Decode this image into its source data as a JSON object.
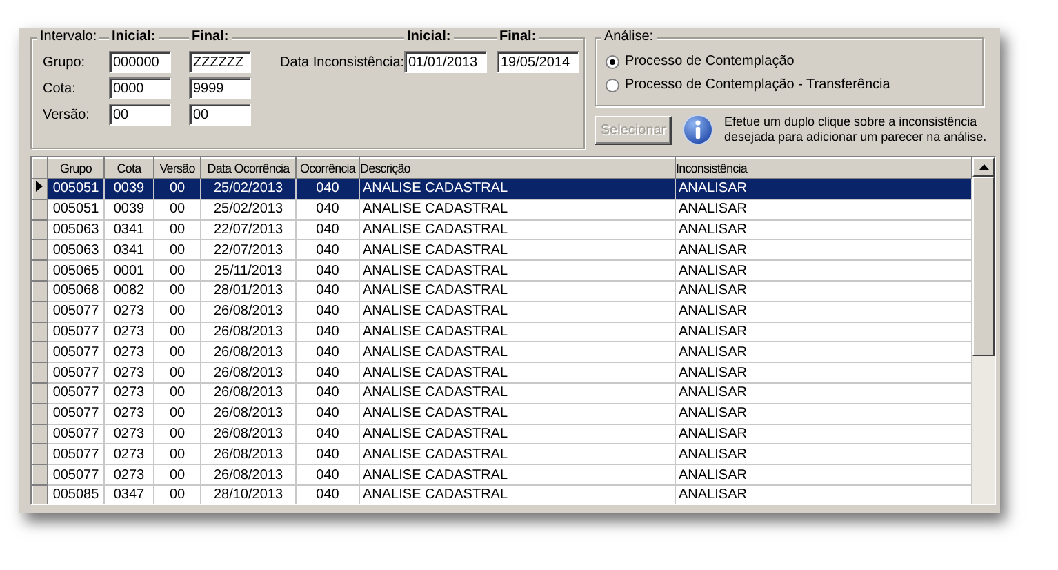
{
  "intervalo": {
    "title": "Intervalo:",
    "col_headers": [
      "Inicial:",
      "Final:"
    ],
    "rows": [
      {
        "label": "Grupo:",
        "inicial": "000000",
        "final": "ZZZZZZ"
      },
      {
        "label": "Cota:",
        "inicial": "0000",
        "final": "9999"
      },
      {
        "label": "Versão:",
        "inicial": "00",
        "final": "00"
      }
    ],
    "data": {
      "label": "Data Inconsistência:",
      "col_headers": [
        "Inicial:",
        "Final:"
      ],
      "inicial": "01/01/2013",
      "final": "19/05/2014"
    }
  },
  "analise": {
    "title": "Análise:",
    "options": [
      {
        "label": "Processo de Contemplação",
        "selected": true
      },
      {
        "label": "Processo de Contemplação - Transferência",
        "selected": false
      }
    ]
  },
  "select_button": {
    "label": "Selecionar",
    "disabled": true
  },
  "info": "Efetue um duplo clique sobre a inconsistência desejada para adicionar um parecer na análise.",
  "table": {
    "columns": [
      "Grupo",
      "Cota",
      "Versão",
      "Data Ocorrência",
      "Ocorrência",
      "Descrição",
      "Inconsistência"
    ],
    "rows": [
      {
        "selected": true,
        "cells": [
          "005051",
          "0039",
          "00",
          "25/02/2013",
          "040",
          "ANALISE CADASTRAL",
          "ANALISAR"
        ]
      },
      {
        "selected": false,
        "cells": [
          "005051",
          "0039",
          "00",
          "25/02/2013",
          "040",
          "ANALISE CADASTRAL",
          "ANALISAR"
        ]
      },
      {
        "selected": false,
        "cells": [
          "005063",
          "0341",
          "00",
          "22/07/2013",
          "040",
          "ANALISE CADASTRAL",
          "ANALISAR"
        ]
      },
      {
        "selected": false,
        "cells": [
          "005063",
          "0341",
          "00",
          "22/07/2013",
          "040",
          "ANALISE CADASTRAL",
          "ANALISAR"
        ]
      },
      {
        "selected": false,
        "cells": [
          "005065",
          "0001",
          "00",
          "25/11/2013",
          "040",
          "ANALISE CADASTRAL",
          "ANALISAR"
        ]
      },
      {
        "selected": false,
        "cells": [
          "005068",
          "0082",
          "00",
          "28/01/2013",
          "040",
          "ANALISE CADASTRAL",
          "ANALISAR"
        ]
      },
      {
        "selected": false,
        "cells": [
          "005077",
          "0273",
          "00",
          "26/08/2013",
          "040",
          "ANALISE CADASTRAL",
          "ANALISAR"
        ]
      },
      {
        "selected": false,
        "cells": [
          "005077",
          "0273",
          "00",
          "26/08/2013",
          "040",
          "ANALISE CADASTRAL",
          "ANALISAR"
        ]
      },
      {
        "selected": false,
        "cells": [
          "005077",
          "0273",
          "00",
          "26/08/2013",
          "040",
          "ANALISE CADASTRAL",
          "ANALISAR"
        ]
      },
      {
        "selected": false,
        "cells": [
          "005077",
          "0273",
          "00",
          "26/08/2013",
          "040",
          "ANALISE CADASTRAL",
          "ANALISAR"
        ]
      },
      {
        "selected": false,
        "cells": [
          "005077",
          "0273",
          "00",
          "26/08/2013",
          "040",
          "ANALISE CADASTRAL",
          "ANALISAR"
        ]
      },
      {
        "selected": false,
        "cells": [
          "005077",
          "0273",
          "00",
          "26/08/2013",
          "040",
          "ANALISE CADASTRAL",
          "ANALISAR"
        ]
      },
      {
        "selected": false,
        "cells": [
          "005077",
          "0273",
          "00",
          "26/08/2013",
          "040",
          "ANALISE CADASTRAL",
          "ANALISAR"
        ]
      },
      {
        "selected": false,
        "cells": [
          "005077",
          "0273",
          "00",
          "26/08/2013",
          "040",
          "ANALISE CADASTRAL",
          "ANALISAR"
        ]
      },
      {
        "selected": false,
        "cells": [
          "005077",
          "0273",
          "00",
          "26/08/2013",
          "040",
          "ANALISE CADASTRAL",
          "ANALISAR"
        ]
      },
      {
        "selected": false,
        "cells": [
          "005085",
          "0347",
          "00",
          "28/10/2013",
          "040",
          "ANALISE CADASTRAL",
          "ANALISAR"
        ]
      }
    ]
  }
}
